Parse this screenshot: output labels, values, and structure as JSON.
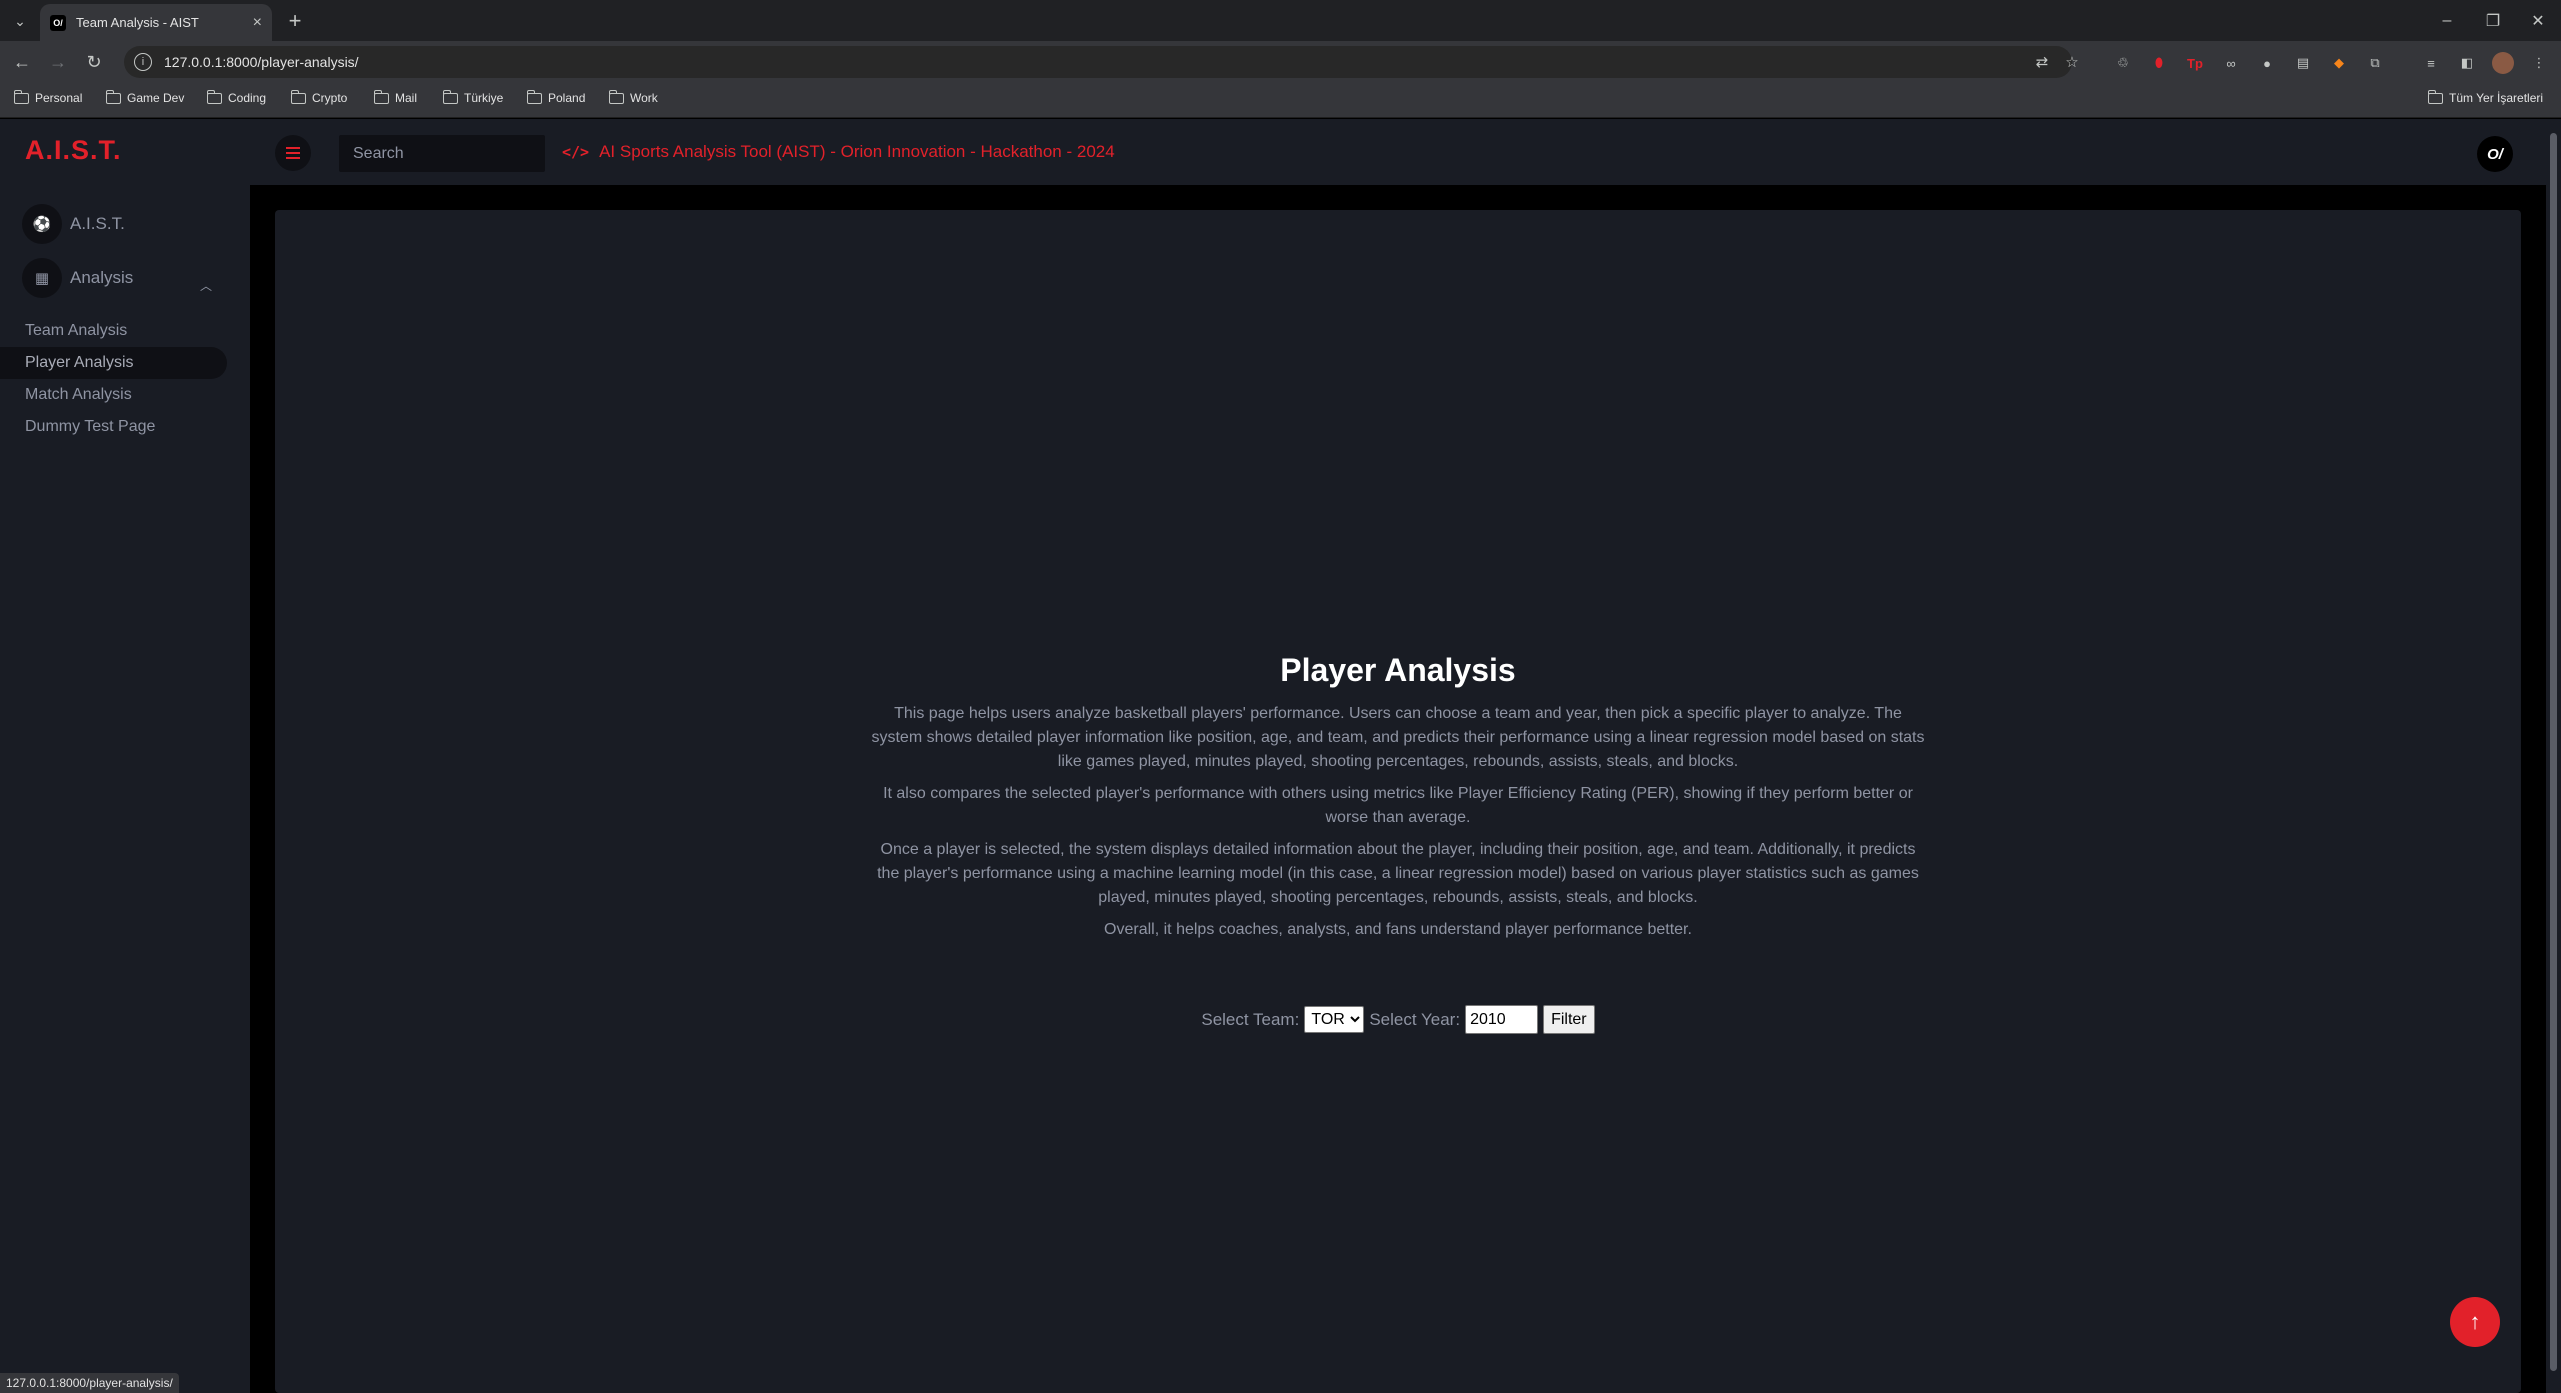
{
  "browser": {
    "tab_title": "Team Analysis - AIST",
    "favicon_text": "O/",
    "url": "127.0.0.1:8000/player-analysis/",
    "bookmarks": [
      "Personal",
      "Game Dev",
      "Coding",
      "Crypto",
      "Mail",
      "Türkiye",
      "Poland",
      "Work"
    ],
    "all_bookmarks_label": "Tüm Yer İşaretleri",
    "status_url": "127.0.0.1:8000/player-analysis/"
  },
  "sidebar": {
    "brand": "A.I.S.T.",
    "home_label": "A.I.S.T.",
    "analysis_label": "Analysis",
    "sub_items": [
      {
        "label": "Team Analysis"
      },
      {
        "label": "Player Analysis"
      },
      {
        "label": "Match Analysis"
      },
      {
        "label": "Dummy Test Page"
      }
    ],
    "active_item": "Player Analysis"
  },
  "navbar": {
    "search_placeholder": "Search",
    "headline": "AI Sports Analysis Tool (AIST) - Orion Innovation - Hackathon - 2024",
    "logo_text": "O/"
  },
  "main": {
    "title": "Player Analysis",
    "paragraphs": [
      "This page helps users analyze basketball players' performance. Users can choose a team and year, then pick a specific player to analyze. The system shows detailed player information like position, age, and team, and predicts their performance using a linear regression model based on stats like games played, minutes played, shooting percentages, rebounds, assists, steals, and blocks.",
      "It also compares the selected player's performance with others using metrics like Player Efficiency Rating (PER), showing if they perform better or worse than average.",
      "Once a player is selected, the system displays detailed information about the player, including their position, age, and team. Additionally, it predicts the player's performance using a machine learning model (in this case, a linear regression model) based on various player statistics such as games played, minutes played, shooting percentages, rebounds, assists, steals, and blocks.",
      "Overall, it helps coaches, analysts, and fans understand player performance better."
    ],
    "filter": {
      "team_label": "Select Team:",
      "team_value": "TOR",
      "year_label": "Select Year:",
      "year_value": "2010",
      "button_label": "Filter"
    }
  },
  "colors": {
    "accent": "#e2212a",
    "sidebar_bg": "#191c24",
    "page_bg": "#000000",
    "muted_text": "#8f94a3"
  },
  "icons": {
    "home": "soccer-ball-icon",
    "analysis": "bar-chart-icon",
    "headline": "code-icon",
    "scroll_top": "arrow-up-icon"
  }
}
